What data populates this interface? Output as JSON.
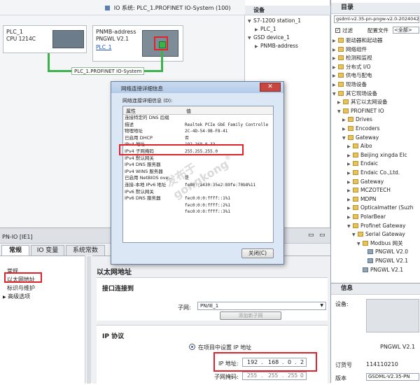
{
  "topology": {
    "header_title": "IO 系统: PLC_1.PROFINET IO-System (100)",
    "plc": {
      "name": "PLC_1",
      "model": "CPU 1214C"
    },
    "device": {
      "name": "PNMB-address",
      "model": "PNGWL V2.1",
      "link": "PLC_1"
    },
    "network_label": "PLC_1.PROFINET IO-System"
  },
  "devices_panel": {
    "title": "设备",
    "items": [
      "S7-1200 station_1",
      "PLC_1",
      "GSD device_1",
      "PNMB-address"
    ]
  },
  "catalog": {
    "title": "目录",
    "file": "gsdml-v2.35-pn-pngw-v2.0-2024042",
    "filter_label": "过滤",
    "profile_label": "配置文件",
    "profile_value": "<全部>",
    "items": [
      {
        "label": "驱动器和起动器",
        "level": 1
      },
      {
        "label": "网络组件",
        "level": 1
      },
      {
        "label": "检测和监视",
        "level": 1
      },
      {
        "label": "分布式 I/O",
        "level": 1
      },
      {
        "label": "供电与配电",
        "level": 1
      },
      {
        "label": "现场设备",
        "level": 1
      },
      {
        "label": "其它现场设备",
        "level": 1
      },
      {
        "label": "其它以太网设备",
        "level": 2
      },
      {
        "label": "PROFINET IO",
        "level": 2
      },
      {
        "label": "Drives",
        "level": 3
      },
      {
        "label": "Encoders",
        "level": 3
      },
      {
        "label": "Gateway",
        "level": 3
      },
      {
        "label": "Aibo",
        "level": 4
      },
      {
        "label": "Beijing xingda Elc",
        "level": 4
      },
      {
        "label": "Endaic",
        "level": 4
      },
      {
        "label": "Endaic Co.,Ltd.",
        "level": 4
      },
      {
        "label": "Gateway",
        "level": 4
      },
      {
        "label": "MCZOTECH",
        "level": 4
      },
      {
        "label": "MDPN",
        "level": 4
      },
      {
        "label": "Opticalmatter (Suzh",
        "level": 4
      },
      {
        "label": "PolarBear",
        "level": 4
      },
      {
        "label": "Profinet Gateway",
        "level": 4
      },
      {
        "label": "Serial Gateway",
        "level": 5
      },
      {
        "label": "Modbus 网关",
        "level": 6
      },
      {
        "label": "PNGWL V2.0",
        "level": 7
      },
      {
        "label": "PNGWL V2.1",
        "level": 7
      },
      {
        "label": "PNGWL V2.1",
        "level": 6
      }
    ]
  },
  "info_panel": {
    "title": "信息",
    "device_label": "设备:",
    "device_name": "PNGWL V2.1",
    "order_label": "订货号",
    "order_value": "114110210",
    "version_label": "版本",
    "version_value": "GSDML-V2.35-PN"
  },
  "dialog": {
    "title": "网络连接详细信息",
    "subtitle": "网络连接详细信息 (D):",
    "col_property": "属性",
    "col_value": "值",
    "rows": [
      [
        "连接特定的 DNS 后缀",
        ""
      ],
      [
        "描述",
        "Realtek PCIe GbE Family Controlle"
      ],
      [
        "物理地址",
        "2C-4D-54-9B-F8-41"
      ],
      [
        "已启用 DHCP",
        "否"
      ],
      [
        "IPv4 地址",
        "192.168.0.33"
      ],
      [
        "IPv4 子网掩码",
        "255.255.255.0"
      ],
      [
        "IPv4 默认网关",
        ""
      ],
      [
        "IPv4 DNS 服务器",
        ""
      ],
      [
        "IPv4 WINS 服务器",
        ""
      ],
      [
        "已启用 NetBIOS ove...",
        "是"
      ],
      [
        "连接-本地 IPv6 地址",
        "fe80::a430:35e2:89fe:70b8%11"
      ],
      [
        "IPv6 默认网关",
        ""
      ],
      [
        "IPv6 DNS 服务器",
        "fec0:0:0:ffff::1%1"
      ],
      [
        "",
        "fec0:0:0:ffff::2%1"
      ],
      [
        "",
        "fec0:0:0:ffff::3%1"
      ]
    ],
    "close_label": "关闭(C)",
    "close_icon": "close-x-icon"
  },
  "properties": {
    "window_title": "PN-IO [IE1]",
    "tabs": [
      "常规",
      "IO 变量",
      "系统常数"
    ],
    "nav_items": [
      "常规",
      "以太网地址",
      "标识与维护",
      "高级选项"
    ],
    "section_title": "以太网地址",
    "interface_title": "接口连接到",
    "subnet_label": "子网:",
    "subnet_value": "PN/IE_1",
    "add_subnet_label": "添加新子网",
    "ip_protocol_title": "IP 协议",
    "radio_label": "在项目中设置 IP 地址",
    "ip_label": "IP 地址:",
    "ip_octets": [
      "192",
      "168",
      "0",
      "2"
    ],
    "mask_label": "子网掩码:",
    "mask_octets": [
      "255",
      "255",
      "255",
      "0"
    ]
  },
  "watermark": {
    "line1": "发布于",
    "line2": "gongkong",
    "mark": "®"
  },
  "colors": {
    "highlight": "#e0232b",
    "network_green": "#3cb34a",
    "selected_blue": "#2e6bd8"
  }
}
